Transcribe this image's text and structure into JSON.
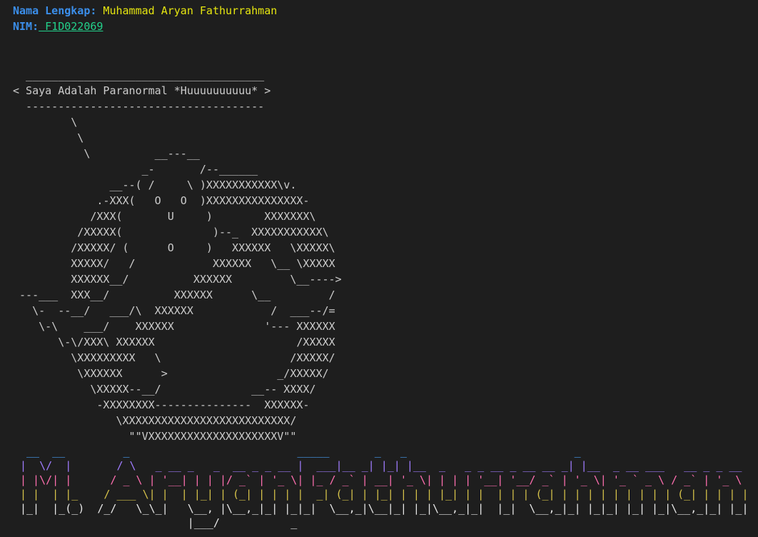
{
  "info": {
    "name_label": "Nama Lengkap:",
    "name_value": " Muhammad Aryan Fathurrahman",
    "nim_label": "NIM:",
    "nim_value": " F1D022069"
  },
  "cowsay": {
    "speech_top": "  _____________________________________",
    "speech_text": "< Saya Adalah Paranormal *Huuuuuuuuuu* >",
    "speech_bottom": "  -------------------------------------",
    "art": "         \\\n          \\\n           \\          __---__\n                    _-       /--______\n               __--( /     \\ )XXXXXXXXXXX\\v.\n             .-XXX(   O   O  )XXXXXXXXXXXXXXX-\n            /XXX(       U     )        XXXXXXX\\\n          /XXXXX(              )--_  XXXXXXXXXXX\\\n         /XXXXX/ (      O     )   XXXXXX   \\XXXXX\\\n         XXXXX/   /            XXXXXX   \\__ \\XXXXX\n         XXXXXX__/          XXXXXX         \\__---->\n ---___  XXX__/          XXXXXX      \\__         /\n   \\-  --__/   ___/\\  XXXXXX            /  ___--/=\n    \\-\\    ___/    XXXXXX              '--- XXXXXX\n       \\-\\/XXX\\ XXXXXX                      /XXXXX\n         \\XXXXXXXXX   \\                    /XXXXX/\n          \\XXXXXX      >                 _/XXXXX/\n            \\XXXXX--__/              __-- XXXX/\n             -XXXXXXXX---------------  XXXXXX-\n                \\XXXXXXXXXXXXXXXXXXXXXXXXXX/\n                  \"\"VXXXXXXXXXXXXXXXXXXXXV\"\""
  },
  "figlet": {
    "lines": [
      " __  __         _                          _____       _   _                          _",
      "|  \\/  |       / \\   _ __ _   _  __ _ _ __ |  ___|__ _| |_| |__  _   _ _ __ _ __ __ _| |__  _ __ ___   __ _ _ __",
      "| |\\/| |      / _ \\ | '__| | | |/ _` | '_ \\| |_ / _` | __| '_ \\| | | | '__| '__/ _` | '_ \\| '_ ` _ \\ / _` | '_ \\",
      "| |  | |_    / ___ \\| |  | |_| | (_| | | | |  _| (_| | |_| | | | |_| | |  | | | (_| | | | | | | | | | (_| | | | |",
      "|_|  |_(_)  /_/   \\_\\_|   \\__, |\\__,_|_| |_|_|  \\__,_|\\__|_| |_|\\__,_|_|  |_|  \\__,_|_| |_|_| |_| |_|\\__,_|_| |_|",
      "                          |___/           _"
    ]
  }
}
